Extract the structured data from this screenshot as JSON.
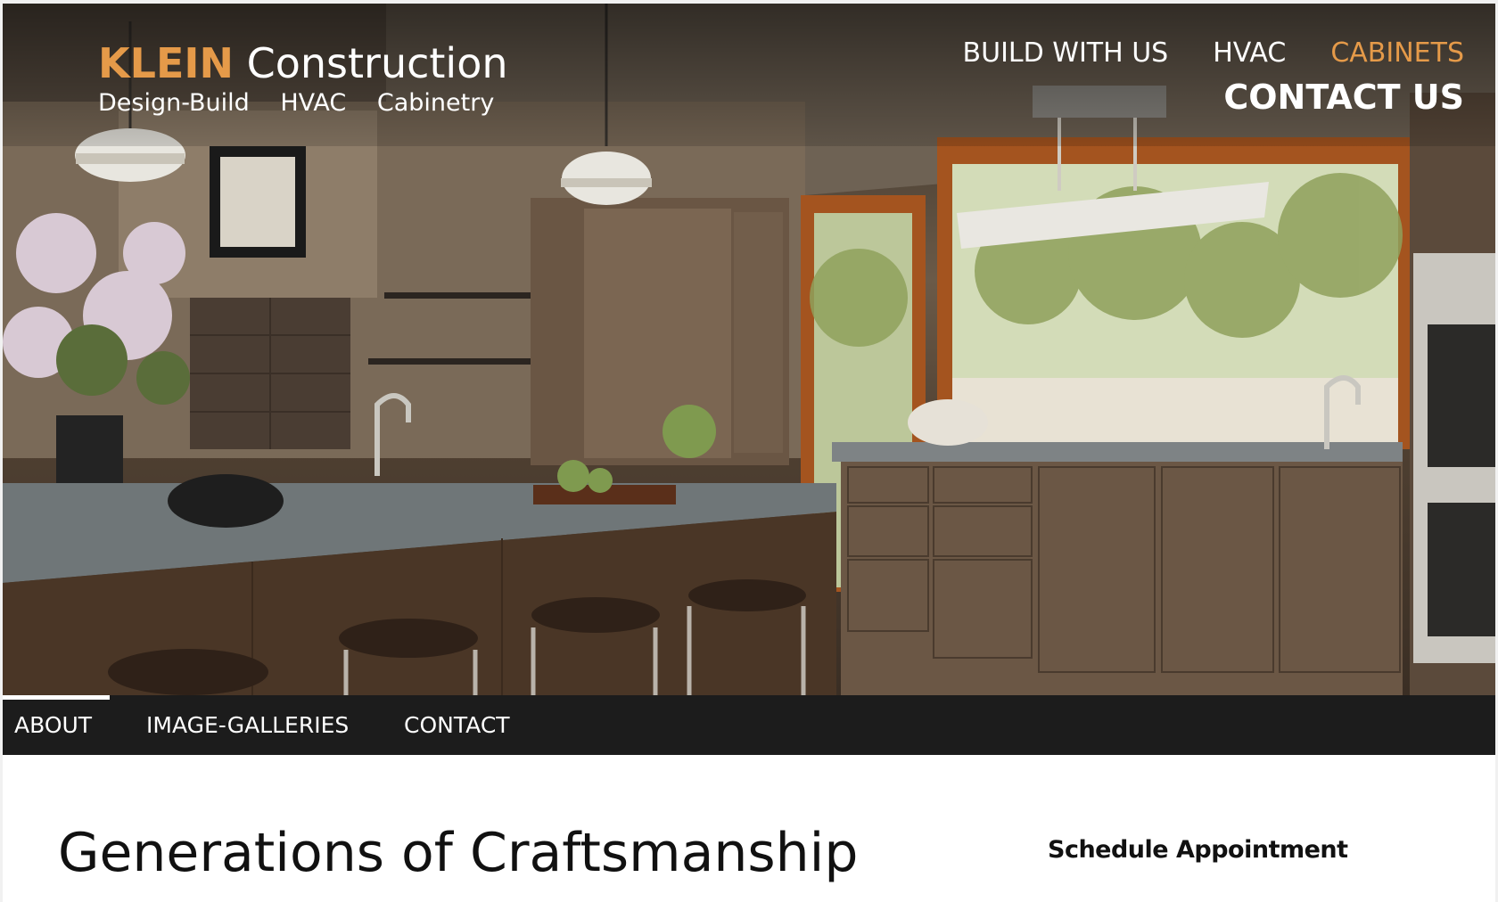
{
  "brand": {
    "name_strong": "KLEIN",
    "name_rest": " Construction",
    "tagline": [
      "Design-Build",
      "HVAC",
      "Cabinetry"
    ]
  },
  "top_nav": {
    "items": [
      {
        "label": "BUILD WITH US",
        "active": false
      },
      {
        "label": "HVAC",
        "active": false
      },
      {
        "label": "CABINETS",
        "active": true
      }
    ],
    "contact_label": "CONTACT US"
  },
  "sub_nav": {
    "items": [
      {
        "label": "ABOUT",
        "active": true
      },
      {
        "label": "IMAGE-GALLERIES",
        "active": false
      },
      {
        "label": "CONTACT",
        "active": false
      }
    ]
  },
  "main": {
    "headline": "Generations of Craftsmanship"
  },
  "sidebar": {
    "title": "Schedule Appointment"
  },
  "colors": {
    "accent": "#e59a49",
    "nav_bar": "#1c1c1c",
    "text": "#111111"
  },
  "hero": {
    "image_icon": "kitchen-photo"
  }
}
